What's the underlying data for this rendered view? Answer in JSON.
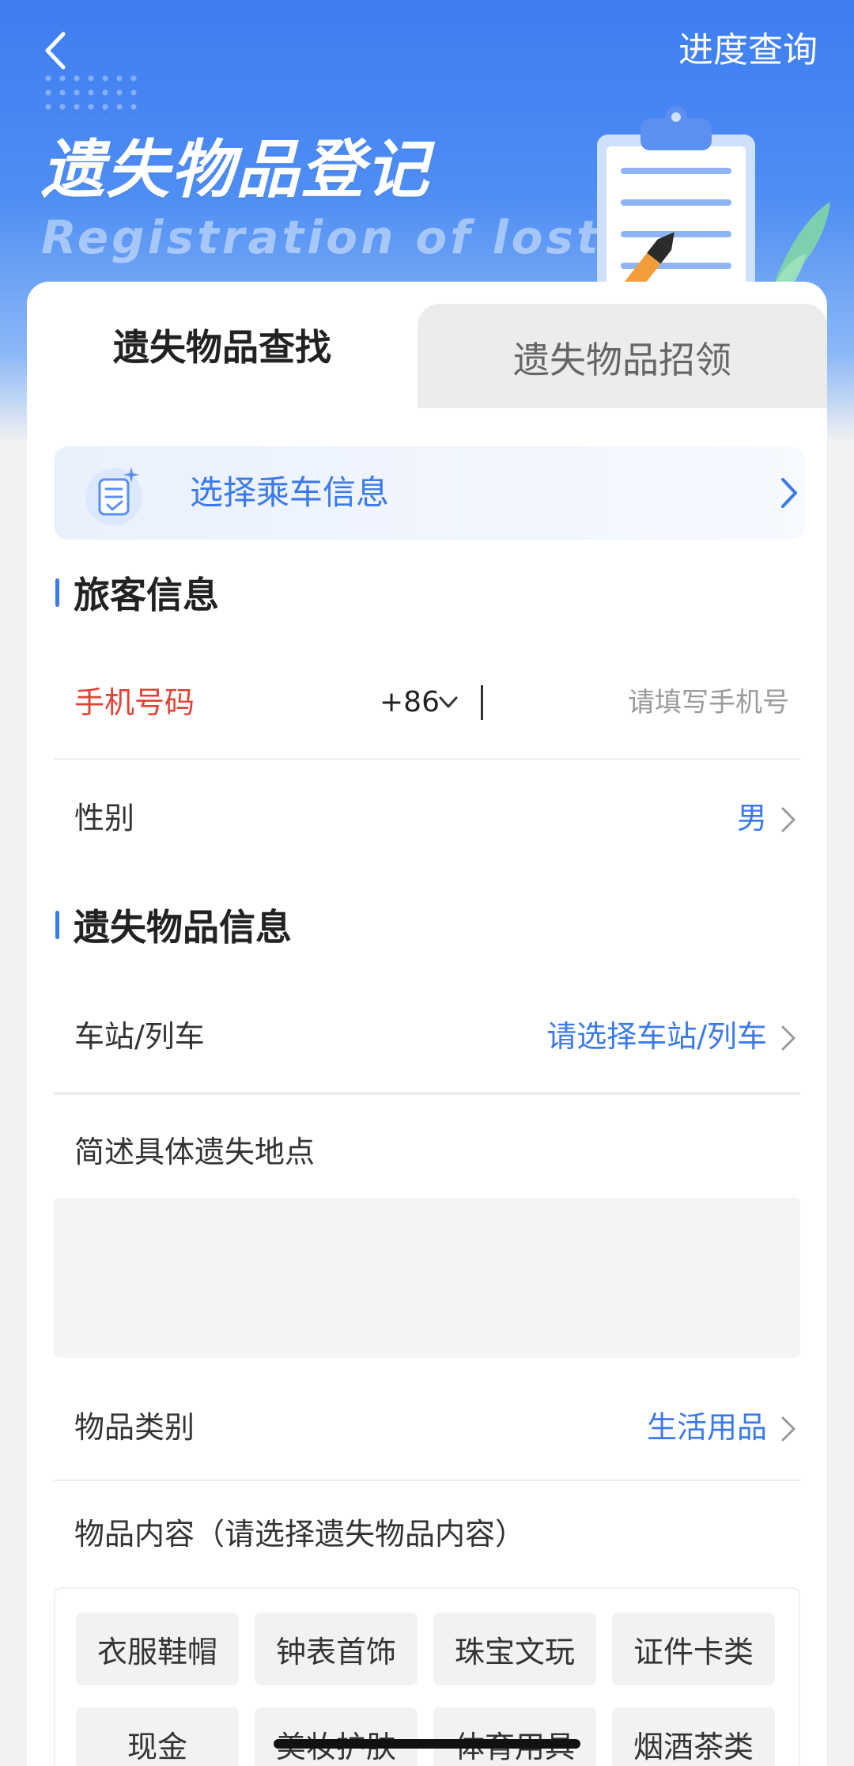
{
  "header": {
    "progress_link": "进度查询",
    "title": "遗失物品登记",
    "subtitle": "Registration of lost"
  },
  "tabs": [
    {
      "label": "遗失物品查找",
      "active": true
    },
    {
      "label": "遗失物品招领",
      "active": false
    }
  ],
  "ride_banner": {
    "label": "选择乘车信息"
  },
  "passenger_section": {
    "title": "旅客信息",
    "phone": {
      "label": "手机号码",
      "country_code": "+86",
      "value": "",
      "placeholder": "请填写手机号"
    },
    "gender": {
      "label": "性别",
      "value": "男"
    }
  },
  "lost_item_section": {
    "title": "遗失物品信息",
    "station": {
      "label": "车站/列车",
      "value": "请选择车站/列车"
    },
    "location": {
      "label": "简述具体遗失地点",
      "value": ""
    },
    "category": {
      "label": "物品类别",
      "value": "生活用品"
    },
    "content_label": "物品内容（请选择遗失物品内容）",
    "content_options": [
      "衣服鞋帽",
      "钟表首饰",
      "珠宝文玩",
      "证件卡类",
      "现金",
      "美妆护肤",
      "体育用具",
      "烟酒茶类"
    ]
  },
  "colors": {
    "accent": "#3b7ae8",
    "required": "#e34234",
    "header_blue": "#3d7df0"
  },
  "icons": [
    "back-arrow-icon",
    "clipboard-illustration",
    "ride-info-icon",
    "chevron-right-icon",
    "chevron-down-icon"
  ]
}
